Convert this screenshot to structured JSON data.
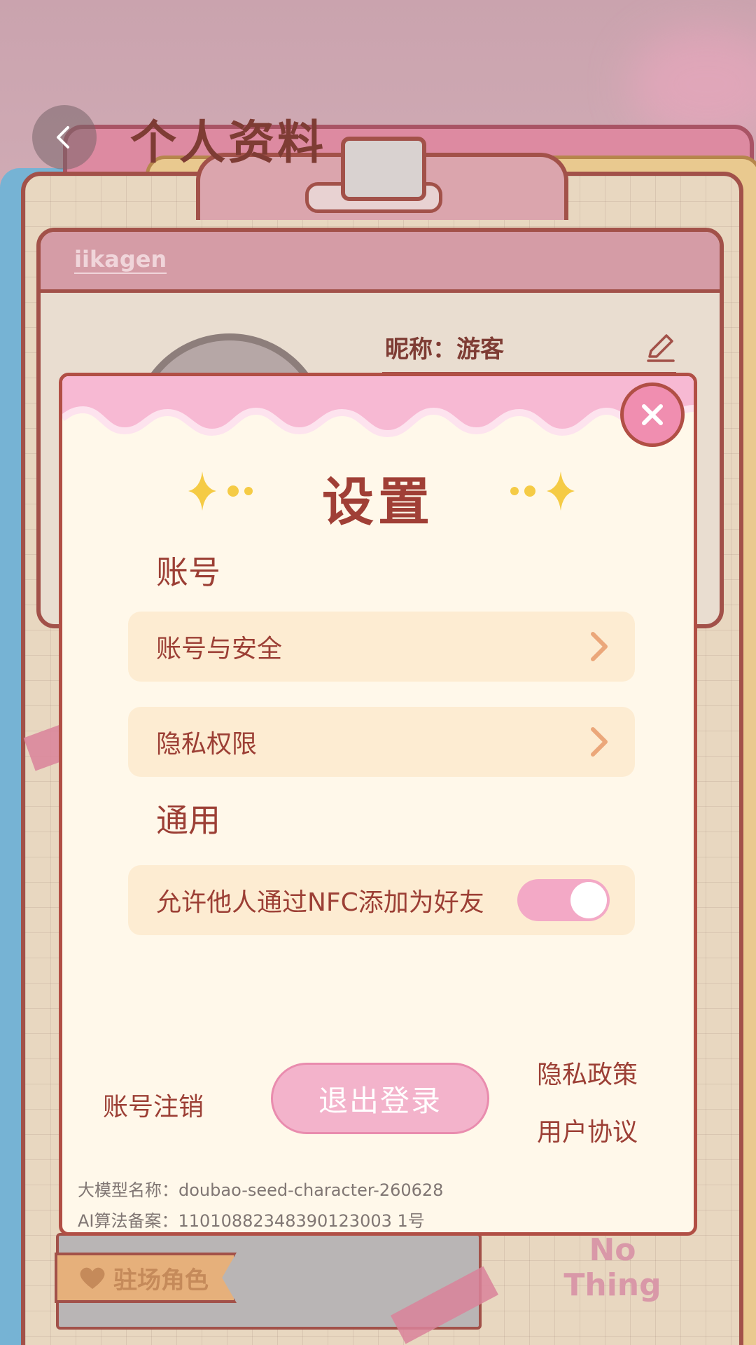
{
  "header": {
    "title": "个人资料"
  },
  "card": {
    "username": "iikagen",
    "nickname": "昵称：游客",
    "role_ribbon": "驻场角色",
    "stamp_text": "No Thing"
  },
  "settings": {
    "title": "设置",
    "sections": [
      {
        "title": "账号",
        "items": [
          {
            "label": "账号与安全"
          },
          {
            "label": "隐私权限"
          }
        ]
      },
      {
        "title": "通用",
        "items": [
          {
            "label": "允许他人通过NFC添加为好友",
            "toggle": true
          }
        ]
      }
    ],
    "account_cancel": "账号注销",
    "logout": "退出登录",
    "privacy_policy": "隐私政策",
    "user_agreement": "用户协议",
    "model_name": "大模型名称：doubao-seed-character-260628",
    "algorithm_record": "AI算法备案：11010882348390123003 1号"
  },
  "colors": {
    "accent": "#a03f36",
    "pink": "#f3a9c6",
    "row_bg": "#fdecd2",
    "modal_bg": "#fff8ea"
  }
}
